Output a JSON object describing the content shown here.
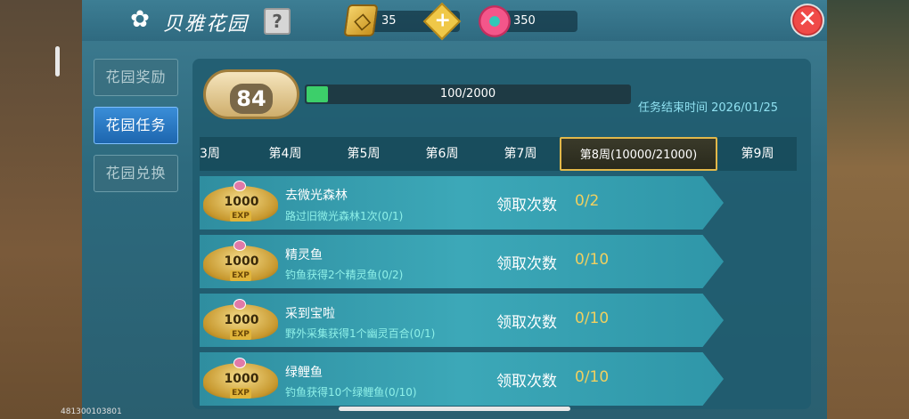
{
  "header": {
    "title": "贝雅花园",
    "help_label": "?",
    "gold_amount": "35",
    "plus_label": "+",
    "flower_amount": "350",
    "close_label": "✕"
  },
  "sidebar": {
    "items": [
      {
        "label": "花园奖励",
        "active": false
      },
      {
        "label": "花园任务",
        "active": true
      },
      {
        "label": "花园兑换",
        "active": false
      }
    ]
  },
  "level": {
    "value": "84",
    "progress_text": "100/2000",
    "progress_fraction": 0.05,
    "end_time": "任务结束时间 2026/01/25"
  },
  "tabs": [
    {
      "label": "3周",
      "active": false
    },
    {
      "label": "第4周",
      "active": false
    },
    {
      "label": "第5周",
      "active": false
    },
    {
      "label": "第6周",
      "active": false
    },
    {
      "label": "第7周",
      "active": false
    },
    {
      "label": "第8周(10000/21000)",
      "active": true
    },
    {
      "label": "第9周",
      "active": false
    }
  ],
  "tasks": [
    {
      "reward": "1000",
      "reward_tag": "EXP",
      "name": "去微光森林",
      "desc": "路过旧微光森林1次(0/1)",
      "claim_label": "领取次数",
      "claim_value": "0/2"
    },
    {
      "reward": "1000",
      "reward_tag": "EXP",
      "name": "精灵鱼",
      "desc": "钓鱼获得2个精灵鱼(0/2)",
      "claim_label": "领取次数",
      "claim_value": "0/10"
    },
    {
      "reward": "1000",
      "reward_tag": "EXP",
      "name": "采到宝啦",
      "desc": "野外采集获得1个幽灵百合(0/1)",
      "claim_label": "领取次数",
      "claim_value": "0/10"
    },
    {
      "reward": "1000",
      "reward_tag": "EXP",
      "name": "绿鲤鱼",
      "desc": "钓鱼获得10个绿鲤鱼(0/10)",
      "claim_label": "领取次数",
      "claim_value": "0/10"
    }
  ],
  "footer": {
    "id_text": "481300103801"
  },
  "colors": {
    "panel": "#2d6a7e",
    "accent_gold": "#e2b84a",
    "progress_green": "#3ccf6a",
    "claim_value": "#f0d060"
  }
}
